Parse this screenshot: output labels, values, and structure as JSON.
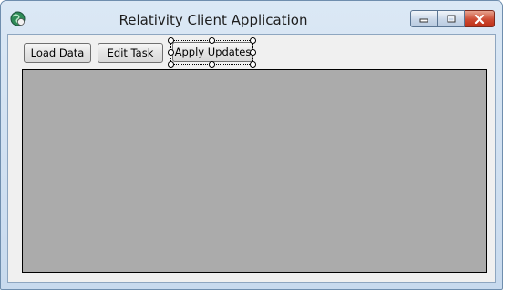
{
  "window": {
    "title": "Relativity Client Application",
    "icon": "app-globe-icon",
    "controls": [
      "minimize-icon",
      "maximize-icon",
      "close-icon"
    ]
  },
  "toolbar": {
    "load_label": "Load Data",
    "edit_label": "Edit Task",
    "apply_label": "Apply Updates"
  },
  "colors": {
    "panel": "#ababab",
    "client": "#f0f0f0",
    "close_button": "#c9432d"
  }
}
